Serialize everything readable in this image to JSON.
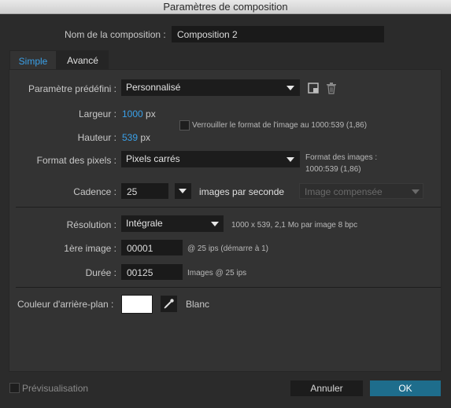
{
  "window": {
    "title": "Paramètres de composition"
  },
  "comp_name": {
    "label": "Nom de la composition :",
    "value": "Composition 2"
  },
  "tabs": [
    {
      "label": "Simple"
    },
    {
      "label": "Avancé"
    }
  ],
  "preset": {
    "label": "Paramètre prédéfini :",
    "value": "Personnalisé"
  },
  "width": {
    "label": "Largeur :",
    "value": "1000",
    "unit": "px"
  },
  "height": {
    "label": "Hauteur :",
    "value": "539",
    "unit": "px"
  },
  "lock_aspect": {
    "label": "Verrouiller le format de l'image au 1000:539 (1,86)",
    "checked": false
  },
  "pixel_aspect": {
    "label": "Format des pixels :",
    "value": "Pixels carrés",
    "frame_aspect_line1": "Format des images :",
    "frame_aspect_line2": "1000:539 (1,86)"
  },
  "framerate": {
    "label": "Cadence :",
    "value": "25",
    "unit": "images par seconde",
    "drop_frame": "Image compensée"
  },
  "resolution": {
    "label": "Résolution :",
    "value": "Intégrale",
    "info": "1000 x 539, 2,1 Mo par image 8 bpc"
  },
  "start_frame": {
    "label": "1ère image :",
    "value": "00001",
    "info": "@ 25 ips (démarre à 1)"
  },
  "duration": {
    "label": "Durée :",
    "value": "00125",
    "info": "Images @ 25 ips"
  },
  "background": {
    "label": "Couleur d'arrière-plan :",
    "color_name": "Blanc",
    "color": "#ffffff"
  },
  "footer": {
    "preview_label": "Prévisualisation",
    "preview_checked": false,
    "cancel_label": "Annuler",
    "ok_label": "OK"
  },
  "colors": {
    "accent": "#3aa0e8",
    "ok_button": "#1e6d8c"
  }
}
